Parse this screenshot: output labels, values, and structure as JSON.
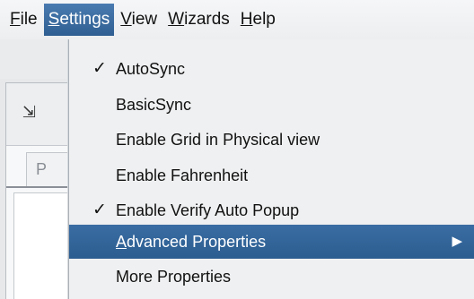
{
  "menubar": {
    "items": [
      {
        "first": "F",
        "rest": "ile"
      },
      {
        "first": "S",
        "rest": "ettings"
      },
      {
        "first": "V",
        "rest": "iew"
      },
      {
        "first": "W",
        "rest": "izards"
      },
      {
        "first": "H",
        "rest": "elp"
      }
    ],
    "active_index": 1
  },
  "background": {
    "dock_icon": "dock-panel-icon",
    "tab_label": "P"
  },
  "settings_menu": {
    "items": [
      {
        "label": "AutoSync",
        "checked": true,
        "check_glyph": "✓"
      },
      {
        "label": "BasicSync",
        "checked": false
      },
      {
        "label": "Enable Grid in Physical view",
        "checked": false
      },
      {
        "label": "Enable Fahrenheit",
        "checked": false
      },
      {
        "label": "Enable Verify Auto Popup",
        "checked": true,
        "check_glyph": "✓"
      },
      {
        "label_first": "A",
        "label_rest": "dvanced Properties",
        "highlighted": true,
        "submenu_arrow": "▶"
      },
      {
        "label": "More Properties",
        "checked": false
      }
    ]
  },
  "colors": {
    "highlight": "#2f5f92",
    "menu_background": "#eff0f1"
  }
}
